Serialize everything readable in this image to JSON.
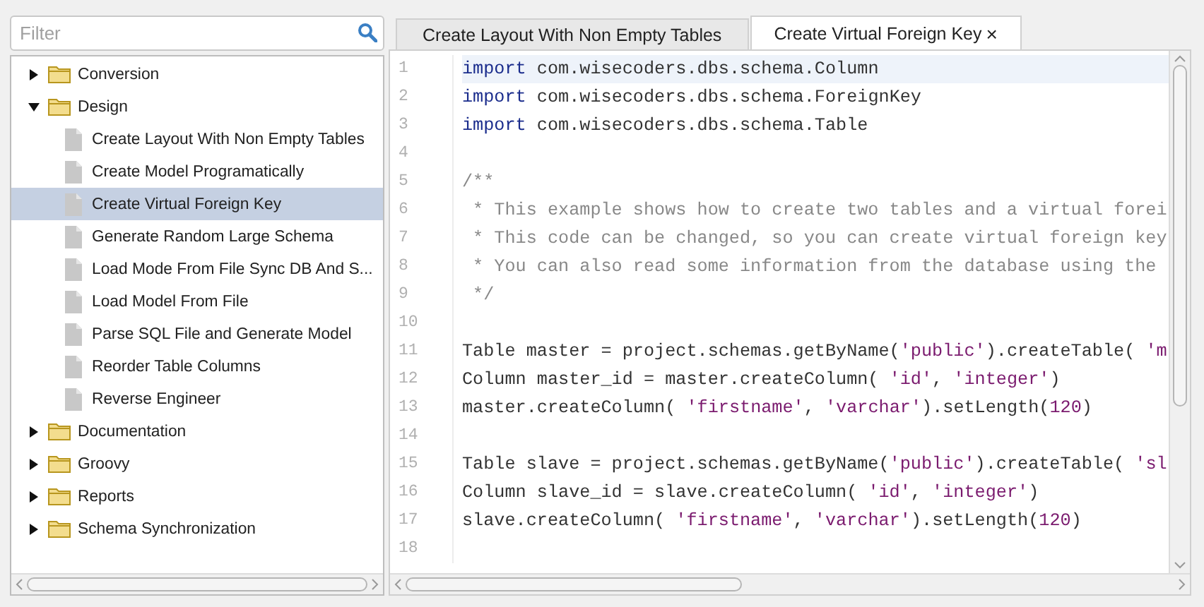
{
  "filter": {
    "placeholder": "Filter"
  },
  "tree": [
    {
      "label": "Conversion",
      "kind": "folder",
      "expanded": false,
      "selected": false
    },
    {
      "label": "Design",
      "kind": "folder",
      "expanded": true,
      "selected": false,
      "children": [
        {
          "label": "Create Layout With Non Empty Tables",
          "kind": "file",
          "selected": false
        },
        {
          "label": "Create Model Programatically",
          "kind": "file",
          "selected": false
        },
        {
          "label": "Create Virtual Foreign Key",
          "kind": "file",
          "selected": true
        },
        {
          "label": "Generate Random Large Schema",
          "kind": "file",
          "selected": false
        },
        {
          "label": "Load Mode From File Sync DB And S...",
          "kind": "file",
          "selected": false
        },
        {
          "label": "Load Model From File",
          "kind": "file",
          "selected": false
        },
        {
          "label": "Parse SQL File and Generate Model",
          "kind": "file",
          "selected": false
        },
        {
          "label": "Reorder Table Columns",
          "kind": "file",
          "selected": false
        },
        {
          "label": "Reverse Engineer",
          "kind": "file",
          "selected": false
        }
      ]
    },
    {
      "label": "Documentation",
      "kind": "folder",
      "expanded": false,
      "selected": false
    },
    {
      "label": "Groovy",
      "kind": "folder",
      "expanded": false,
      "selected": false
    },
    {
      "label": "Reports",
      "kind": "folder",
      "expanded": false,
      "selected": false
    },
    {
      "label": "Schema Synchronization",
      "kind": "folder",
      "expanded": false,
      "selected": false
    }
  ],
  "tabs": [
    {
      "label": "Create Layout With Non Empty Tables",
      "selected": false
    },
    {
      "label": "Create Virtual Foreign Key",
      "selected": true,
      "close": "×"
    }
  ],
  "editor": {
    "lines": [
      {
        "number": "1",
        "current": true,
        "segments": [
          {
            "text": "import",
            "kind": "keyword"
          },
          {
            "text": " com.wisecoders.dbs.schema.Column",
            "kind": "plain"
          }
        ]
      },
      {
        "number": "2",
        "current": false,
        "segments": [
          {
            "text": "import",
            "kind": "keyword"
          },
          {
            "text": " com.wisecoders.dbs.schema.ForeignKey",
            "kind": "plain"
          }
        ]
      },
      {
        "number": "3",
        "current": false,
        "segments": [
          {
            "text": "import",
            "kind": "keyword"
          },
          {
            "text": " com.wisecoders.dbs.schema.Table",
            "kind": "plain"
          }
        ]
      },
      {
        "number": "4",
        "current": false
      },
      {
        "number": "5",
        "current": false,
        "segments": [
          {
            "text": "/**",
            "kind": "comment"
          }
        ]
      },
      {
        "number": "6",
        "current": false,
        "segments": [
          {
            "text": " * This example shows how to create two tables and a virtual forei",
            "kind": "comment"
          }
        ]
      },
      {
        "number": "7",
        "current": false,
        "segments": [
          {
            "text": " * This code can be changed, so you can create virtual foreign key",
            "kind": "comment"
          }
        ]
      },
      {
        "number": "8",
        "current": false,
        "segments": [
          {
            "text": " * You can also read some information from the database using the",
            "kind": "comment"
          }
        ]
      },
      {
        "number": "9",
        "current": false,
        "segments": [
          {
            "text": " */",
            "kind": "comment"
          }
        ]
      },
      {
        "number": "10",
        "current": false
      },
      {
        "number": "11",
        "current": false,
        "segments": [
          {
            "text": "Table master = project.schemas.getByName(",
            "kind": "plain"
          },
          {
            "text": "'public'",
            "kind": "string"
          },
          {
            "text": ").createTable( ",
            "kind": "plain"
          },
          {
            "text": "'m",
            "kind": "string"
          }
        ]
      },
      {
        "number": "12",
        "current": false,
        "segments": [
          {
            "text": "Column master_id = master.createColumn( ",
            "kind": "plain"
          },
          {
            "text": "'id'",
            "kind": "string"
          },
          {
            "text": ", ",
            "kind": "plain"
          },
          {
            "text": "'integer'",
            "kind": "string"
          },
          {
            "text": ")",
            "kind": "plain"
          }
        ]
      },
      {
        "number": "13",
        "current": false,
        "segments": [
          {
            "text": "master.createColumn( ",
            "kind": "plain"
          },
          {
            "text": "'firstname'",
            "kind": "string"
          },
          {
            "text": ", ",
            "kind": "plain"
          },
          {
            "text": "'varchar'",
            "kind": "string"
          },
          {
            "text": ").setLength(",
            "kind": "plain"
          },
          {
            "text": "120",
            "kind": "number"
          },
          {
            "text": ")",
            "kind": "plain"
          }
        ]
      },
      {
        "number": "14",
        "current": false
      },
      {
        "number": "15",
        "current": false,
        "segments": [
          {
            "text": "Table slave = project.schemas.getByName(",
            "kind": "plain"
          },
          {
            "text": "'public'",
            "kind": "string"
          },
          {
            "text": ").createTable( ",
            "kind": "plain"
          },
          {
            "text": "'sl",
            "kind": "string"
          }
        ]
      },
      {
        "number": "16",
        "current": false,
        "segments": [
          {
            "text": "Column slave_id = slave.createColumn( ",
            "kind": "plain"
          },
          {
            "text": "'id'",
            "kind": "string"
          },
          {
            "text": ", ",
            "kind": "plain"
          },
          {
            "text": "'integer'",
            "kind": "string"
          },
          {
            "text": ")",
            "kind": "plain"
          }
        ]
      },
      {
        "number": "17",
        "current": false,
        "segments": [
          {
            "text": "slave.createColumn( ",
            "kind": "plain"
          },
          {
            "text": "'firstname'",
            "kind": "string"
          },
          {
            "text": ", ",
            "kind": "plain"
          },
          {
            "text": "'varchar'",
            "kind": "string"
          },
          {
            "text": ").setLength(",
            "kind": "plain"
          },
          {
            "text": "120",
            "kind": "number"
          },
          {
            "text": ")",
            "kind": "plain"
          }
        ]
      },
      {
        "number": "18",
        "current": false
      }
    ]
  }
}
